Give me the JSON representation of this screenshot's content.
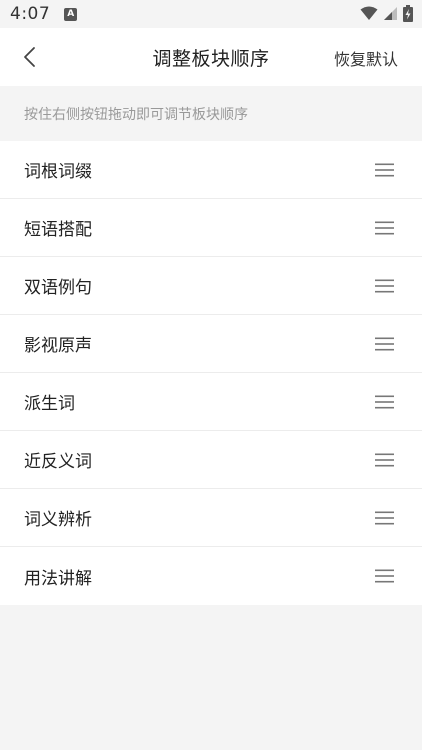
{
  "status_bar": {
    "time": "4:07",
    "app_icon_letter": "A",
    "icons": [
      "wifi-icon",
      "signal-icon",
      "battery-icon"
    ]
  },
  "header": {
    "back_icon": "chevron-left-icon",
    "title": "调整板块顺序",
    "reset_label": "恢复默认"
  },
  "hint": {
    "text": "按住右侧按钮拖动即可调节板块顺序"
  },
  "sections": [
    {
      "label": "词根词缀"
    },
    {
      "label": "短语搭配"
    },
    {
      "label": "双语例句"
    },
    {
      "label": "影视原声"
    },
    {
      "label": "派生词"
    },
    {
      "label": "近反义词"
    },
    {
      "label": "词义辨析"
    },
    {
      "label": "用法讲解"
    }
  ],
  "colors": {
    "background": "#f4f4f4",
    "surface": "#ffffff",
    "text_primary": "#222222",
    "text_hint": "#999999",
    "divider": "#ececec",
    "icon": "#777777"
  }
}
